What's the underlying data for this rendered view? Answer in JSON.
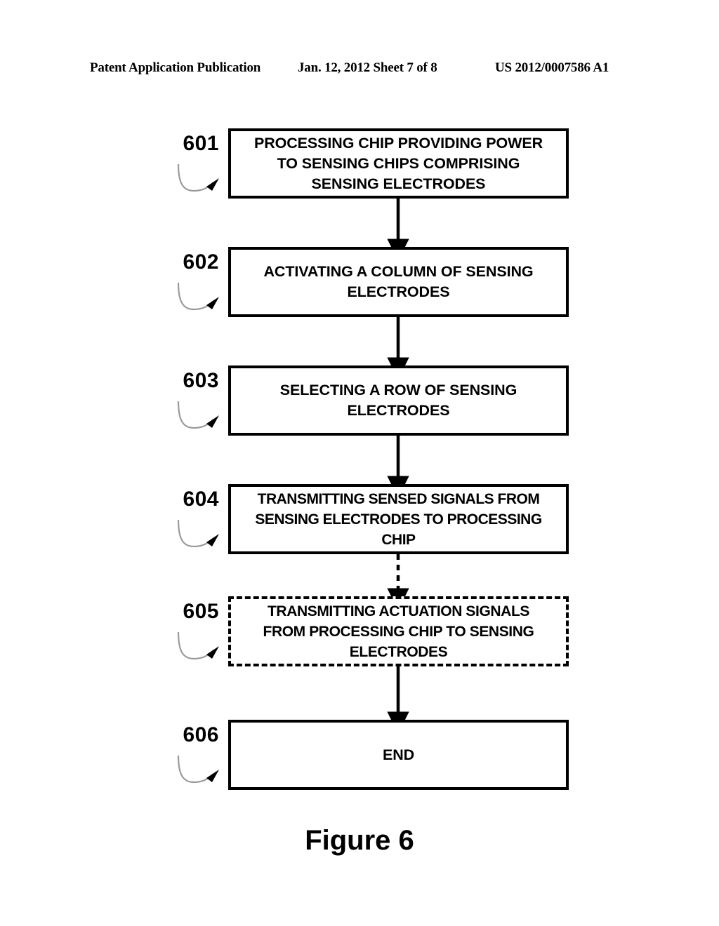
{
  "header": {
    "publication": "Patent Application Publication",
    "date_sheet": "Jan. 12, 2012  Sheet 7 of 8",
    "publication_number": "US 2012/0007586 A1"
  },
  "figure": {
    "caption": "Figure 6",
    "colors": {
      "ink": "#000000",
      "background": "#ffffff",
      "leader_line": "#9a9a9a"
    },
    "steps": [
      {
        "ref": "601",
        "text": "PROCESSING CHIP PROVIDING POWER\nTO SENSING CHIPS COMPRISING\nSENSING ELECTRODES",
        "border": "solid"
      },
      {
        "ref": "602",
        "text": "ACTIVATING A COLUMN OF SENSING\nELECTRODES",
        "border": "solid"
      },
      {
        "ref": "603",
        "text": "SELECTING A ROW OF SENSING\nELECTRODES",
        "border": "solid"
      },
      {
        "ref": "604",
        "text": "TRANSMITTING SENSED SIGNALS FROM\nSENSING ELECTRODES TO PROCESSING\nCHIP",
        "border": "solid"
      },
      {
        "ref": "605",
        "text": "TRANSMITTING ACTUATION SIGNALS\nFROM PROCESSING CHIP TO SENSING\nELECTRODES",
        "border": "dashed"
      },
      {
        "ref": "606",
        "text": "END",
        "border": "solid"
      }
    ],
    "connectors": [
      {
        "from": "601",
        "to": "602",
        "style": "solid"
      },
      {
        "from": "602",
        "to": "603",
        "style": "solid"
      },
      {
        "from": "603",
        "to": "604",
        "style": "solid"
      },
      {
        "from": "604",
        "to": "605",
        "style": "dashed"
      },
      {
        "from": "605",
        "to": "606",
        "style": "solid"
      }
    ]
  }
}
